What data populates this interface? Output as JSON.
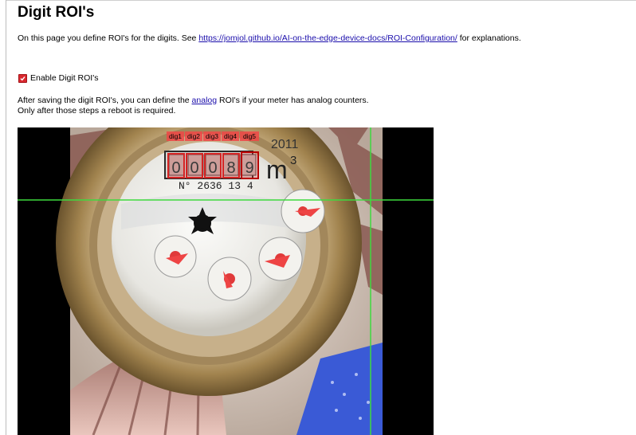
{
  "page": {
    "title": "Digit ROI's",
    "intro": {
      "text_before": "On this page you define ROI's for the digits. See ",
      "link": "https://jomjol.github.io/AI-on-the-edge-device-docs/ROI-Configuration/",
      "text_after": " for explanations."
    },
    "enable_checkbox": {
      "label": "Enable Digit ROI's",
      "checked": true,
      "color": "#d9282f"
    },
    "info_line1": {
      "text_before": "After saving the digit ROI's, you can define the ",
      "link": "analog",
      "text_after": " ROI's if your meter has analog counters."
    },
    "info_line2": "Only after those steps a reboot is required."
  },
  "canvas": {
    "crosshair_color": "#3ed93e",
    "roi_color": "#d42222",
    "meter_print": {
      "year": "2011",
      "unit": "m",
      "unit_sup": "3",
      "serial": "N° 2636 13 4"
    },
    "rois": [
      {
        "label": "dig1",
        "value": "0"
      },
      {
        "label": "dig2",
        "value": "0"
      },
      {
        "label": "dig3",
        "value": "0"
      },
      {
        "label": "dig4",
        "value": "8"
      },
      {
        "label": "dig5",
        "value": "9",
        "selected": true
      }
    ]
  }
}
